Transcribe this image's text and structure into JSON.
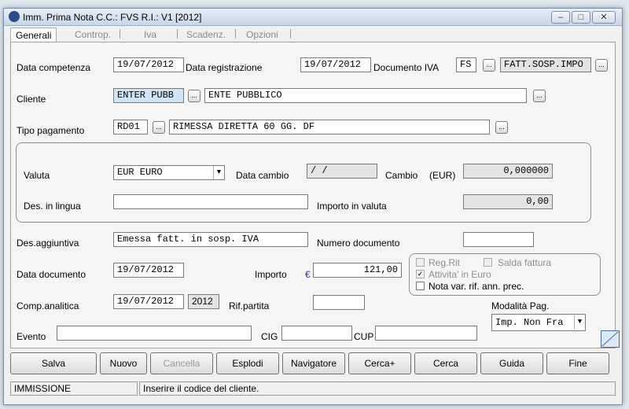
{
  "window": {
    "title": "Imm. Prima Nota C.C.: FVS  R.I.: V1  [2012]"
  },
  "tabs": [
    "Generali",
    "Controp.",
    "Iva",
    "Scadenz.",
    "Opzioni"
  ],
  "labels": {
    "data_competenza": "Data competenza",
    "data_registrazione": "Data registrazione",
    "documento_iva": "Documento IVA",
    "cliente": "Cliente",
    "tipo_pagamento": "Tipo pagamento",
    "valuta": "Valuta",
    "data_cambio": "Data cambio",
    "cambio": "Cambio",
    "cambio_unit": "(EUR)",
    "des_lingua": "Des. in lingua",
    "importo_valuta": "Importo in valuta",
    "des_aggiuntiva": "Des.aggiuntiva",
    "numero_documento": "Numero documento",
    "data_documento": "Data documento",
    "importo": "Importo",
    "euro_symbol": "€",
    "comp_analitica": "Comp.analitica",
    "rif_partita": "Rif.partita",
    "modalita_pag": "Modalità Pag.",
    "evento": "Evento",
    "cig": "CIG",
    "cup": "CUP"
  },
  "fields": {
    "data_competenza": "19/07/2012",
    "data_registrazione": "19/07/2012",
    "doc_iva_code": "FS",
    "doc_iva_desc": "FATT.SOSP.IMPO",
    "cliente_code": "ENTER PUBB",
    "cliente_desc": "ENTE PUBBLICO",
    "pagamento_code": "RD01",
    "pagamento_desc": "RIMESSA DIRETTA 60 GG. DF",
    "valuta": "EUR EURO",
    "data_cambio": " /  /",
    "cambio": "0,000000",
    "des_lingua": "",
    "importo_valuta": "0,00",
    "des_aggiuntiva": "Emessa fatt. in sosp. IVA",
    "numero_documento": "",
    "data_documento": "19/07/2012",
    "importo": "121,00",
    "comp_analitica": "19/07/2012",
    "comp_year": "2012",
    "rif_partita": "",
    "modalita_pag": "Imp. Non Fra",
    "evento": "",
    "cig": "",
    "cup": ""
  },
  "checks": {
    "reg_rit": {
      "label": "Reg.Rit",
      "checked": false
    },
    "salda_fattura": {
      "label": "Salda fattura",
      "checked": false
    },
    "attivita_euro": {
      "label": "Attivita' in Euro",
      "checked": true
    },
    "nota_var": {
      "label": "Nota var. rif. ann. prec.",
      "checked": false
    }
  },
  "buttons": {
    "salva": "Salva",
    "nuovo": "Nuovo",
    "cancella": "Cancella",
    "esplodi": "Esplodi",
    "navigatore": "Navigatore",
    "cerca_plus": "Cerca+",
    "cerca": "Cerca",
    "guida": "Guida",
    "fine": "Fine"
  },
  "ellipsis": "...",
  "status": {
    "mode": "IMMISSIONE",
    "message": "Inserire il codice del cliente."
  }
}
